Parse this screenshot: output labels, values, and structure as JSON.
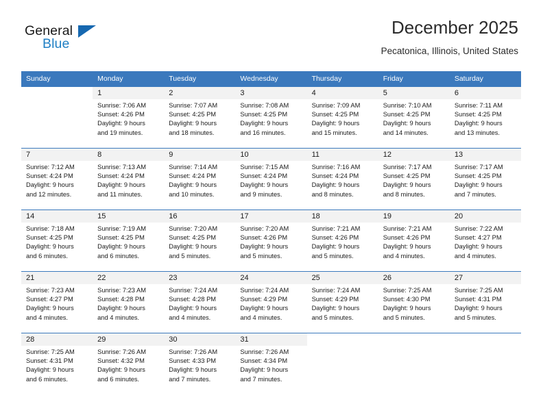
{
  "brand": {
    "word_one": "General",
    "word_two": "Blue",
    "logo_icon": "triangle-logo-icon",
    "accent_color": "#1668b0"
  },
  "header": {
    "title": "December 2025",
    "subtitle": "Pecatonica, Illinois, United States"
  },
  "calendar": {
    "header_bg": "#3b79bd",
    "daynum_bg": "#f2f2f2",
    "weekday_headers": [
      "Sunday",
      "Monday",
      "Tuesday",
      "Wednesday",
      "Thursday",
      "Friday",
      "Saturday"
    ],
    "weeks": [
      [
        {
          "day": "",
          "lines": []
        },
        {
          "day": "1",
          "lines": [
            "Sunrise: 7:06 AM",
            "Sunset: 4:26 PM",
            "Daylight: 9 hours",
            "and 19 minutes."
          ]
        },
        {
          "day": "2",
          "lines": [
            "Sunrise: 7:07 AM",
            "Sunset: 4:25 PM",
            "Daylight: 9 hours",
            "and 18 minutes."
          ]
        },
        {
          "day": "3",
          "lines": [
            "Sunrise: 7:08 AM",
            "Sunset: 4:25 PM",
            "Daylight: 9 hours",
            "and 16 minutes."
          ]
        },
        {
          "day": "4",
          "lines": [
            "Sunrise: 7:09 AM",
            "Sunset: 4:25 PM",
            "Daylight: 9 hours",
            "and 15 minutes."
          ]
        },
        {
          "day": "5",
          "lines": [
            "Sunrise: 7:10 AM",
            "Sunset: 4:25 PM",
            "Daylight: 9 hours",
            "and 14 minutes."
          ]
        },
        {
          "day": "6",
          "lines": [
            "Sunrise: 7:11 AM",
            "Sunset: 4:25 PM",
            "Daylight: 9 hours",
            "and 13 minutes."
          ]
        }
      ],
      [
        {
          "day": "7",
          "lines": [
            "Sunrise: 7:12 AM",
            "Sunset: 4:24 PM",
            "Daylight: 9 hours",
            "and 12 minutes."
          ]
        },
        {
          "day": "8",
          "lines": [
            "Sunrise: 7:13 AM",
            "Sunset: 4:24 PM",
            "Daylight: 9 hours",
            "and 11 minutes."
          ]
        },
        {
          "day": "9",
          "lines": [
            "Sunrise: 7:14 AM",
            "Sunset: 4:24 PM",
            "Daylight: 9 hours",
            "and 10 minutes."
          ]
        },
        {
          "day": "10",
          "lines": [
            "Sunrise: 7:15 AM",
            "Sunset: 4:24 PM",
            "Daylight: 9 hours",
            "and 9 minutes."
          ]
        },
        {
          "day": "11",
          "lines": [
            "Sunrise: 7:16 AM",
            "Sunset: 4:24 PM",
            "Daylight: 9 hours",
            "and 8 minutes."
          ]
        },
        {
          "day": "12",
          "lines": [
            "Sunrise: 7:17 AM",
            "Sunset: 4:25 PM",
            "Daylight: 9 hours",
            "and 8 minutes."
          ]
        },
        {
          "day": "13",
          "lines": [
            "Sunrise: 7:17 AM",
            "Sunset: 4:25 PM",
            "Daylight: 9 hours",
            "and 7 minutes."
          ]
        }
      ],
      [
        {
          "day": "14",
          "lines": [
            "Sunrise: 7:18 AM",
            "Sunset: 4:25 PM",
            "Daylight: 9 hours",
            "and 6 minutes."
          ]
        },
        {
          "day": "15",
          "lines": [
            "Sunrise: 7:19 AM",
            "Sunset: 4:25 PM",
            "Daylight: 9 hours",
            "and 6 minutes."
          ]
        },
        {
          "day": "16",
          "lines": [
            "Sunrise: 7:20 AM",
            "Sunset: 4:25 PM",
            "Daylight: 9 hours",
            "and 5 minutes."
          ]
        },
        {
          "day": "17",
          "lines": [
            "Sunrise: 7:20 AM",
            "Sunset: 4:26 PM",
            "Daylight: 9 hours",
            "and 5 minutes."
          ]
        },
        {
          "day": "18",
          "lines": [
            "Sunrise: 7:21 AM",
            "Sunset: 4:26 PM",
            "Daylight: 9 hours",
            "and 5 minutes."
          ]
        },
        {
          "day": "19",
          "lines": [
            "Sunrise: 7:21 AM",
            "Sunset: 4:26 PM",
            "Daylight: 9 hours",
            "and 4 minutes."
          ]
        },
        {
          "day": "20",
          "lines": [
            "Sunrise: 7:22 AM",
            "Sunset: 4:27 PM",
            "Daylight: 9 hours",
            "and 4 minutes."
          ]
        }
      ],
      [
        {
          "day": "21",
          "lines": [
            "Sunrise: 7:23 AM",
            "Sunset: 4:27 PM",
            "Daylight: 9 hours",
            "and 4 minutes."
          ]
        },
        {
          "day": "22",
          "lines": [
            "Sunrise: 7:23 AM",
            "Sunset: 4:28 PM",
            "Daylight: 9 hours",
            "and 4 minutes."
          ]
        },
        {
          "day": "23",
          "lines": [
            "Sunrise: 7:24 AM",
            "Sunset: 4:28 PM",
            "Daylight: 9 hours",
            "and 4 minutes."
          ]
        },
        {
          "day": "24",
          "lines": [
            "Sunrise: 7:24 AM",
            "Sunset: 4:29 PM",
            "Daylight: 9 hours",
            "and 4 minutes."
          ]
        },
        {
          "day": "25",
          "lines": [
            "Sunrise: 7:24 AM",
            "Sunset: 4:29 PM",
            "Daylight: 9 hours",
            "and 5 minutes."
          ]
        },
        {
          "day": "26",
          "lines": [
            "Sunrise: 7:25 AM",
            "Sunset: 4:30 PM",
            "Daylight: 9 hours",
            "and 5 minutes."
          ]
        },
        {
          "day": "27",
          "lines": [
            "Sunrise: 7:25 AM",
            "Sunset: 4:31 PM",
            "Daylight: 9 hours",
            "and 5 minutes."
          ]
        }
      ],
      [
        {
          "day": "28",
          "lines": [
            "Sunrise: 7:25 AM",
            "Sunset: 4:31 PM",
            "Daylight: 9 hours",
            "and 6 minutes."
          ]
        },
        {
          "day": "29",
          "lines": [
            "Sunrise: 7:26 AM",
            "Sunset: 4:32 PM",
            "Daylight: 9 hours",
            "and 6 minutes."
          ]
        },
        {
          "day": "30",
          "lines": [
            "Sunrise: 7:26 AM",
            "Sunset: 4:33 PM",
            "Daylight: 9 hours",
            "and 7 minutes."
          ]
        },
        {
          "day": "31",
          "lines": [
            "Sunrise: 7:26 AM",
            "Sunset: 4:34 PM",
            "Daylight: 9 hours",
            "and 7 minutes."
          ]
        },
        {
          "day": "",
          "lines": []
        },
        {
          "day": "",
          "lines": []
        },
        {
          "day": "",
          "lines": []
        }
      ]
    ]
  }
}
